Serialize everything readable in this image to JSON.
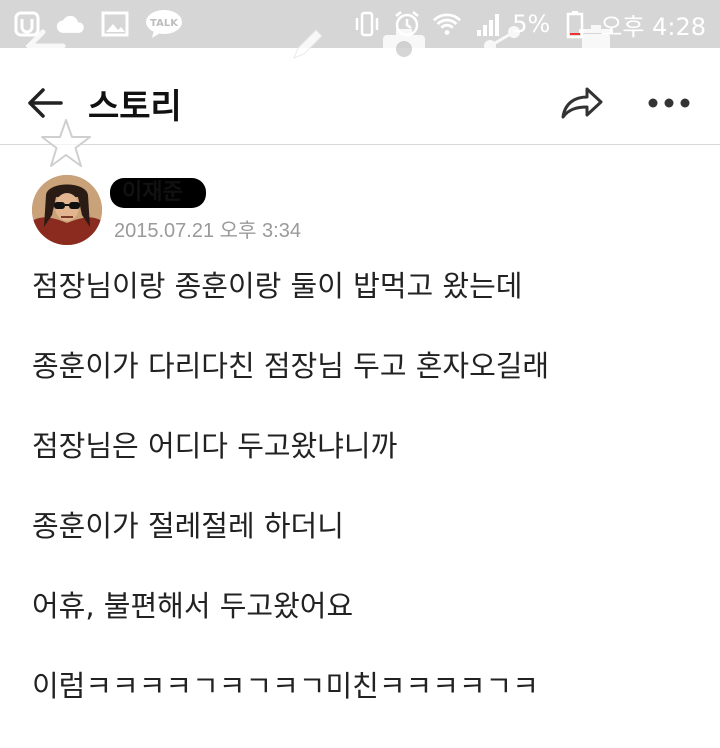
{
  "status_bar": {
    "battery_percent": "5%",
    "time": "오후 4:28",
    "talk_badge": "TALK",
    "left_icons": [
      "kakao-icon",
      "cloud-icon",
      "image-icon",
      "talk-icon"
    ],
    "right_icons": [
      "vibrate-icon",
      "alarm-icon",
      "wifi-icon",
      "signal-icon",
      "battery-icon"
    ]
  },
  "overlay_toolbar": {
    "icons": [
      "back-arrow-icon",
      "pencil-icon",
      "camera-icon",
      "share-icon",
      "trash-icon"
    ]
  },
  "app_bar": {
    "title": "스토리",
    "back_icon": "arrow-left-icon",
    "share_icon": "share-arrow-icon",
    "more_icon": "more-dots-icon"
  },
  "star_icon": "star-outline-icon",
  "post": {
    "author_name": "이재준",
    "timestamp": "2015.07.21 오후 3:34",
    "lines": [
      "점장님이랑 종훈이랑 둘이 밥먹고 왔는데",
      "종훈이가 다리다친 점장님 두고 혼자오길래",
      "점장님은 어디다 두고왔냐니까",
      "종훈이가 절레절레 하더니",
      "어휴,  불편해서 두고왔어요",
      "이럼ㅋㅋㅋㅋㄱㅋㄱㅋㄱ미친ㅋㅋㅋㅋㄱㅋ"
    ]
  },
  "colors": {
    "status_bar_bg": "#d6d6d6",
    "text": "#222222",
    "timestamp": "#9a9a9a",
    "divider": "#d8d8d8"
  }
}
